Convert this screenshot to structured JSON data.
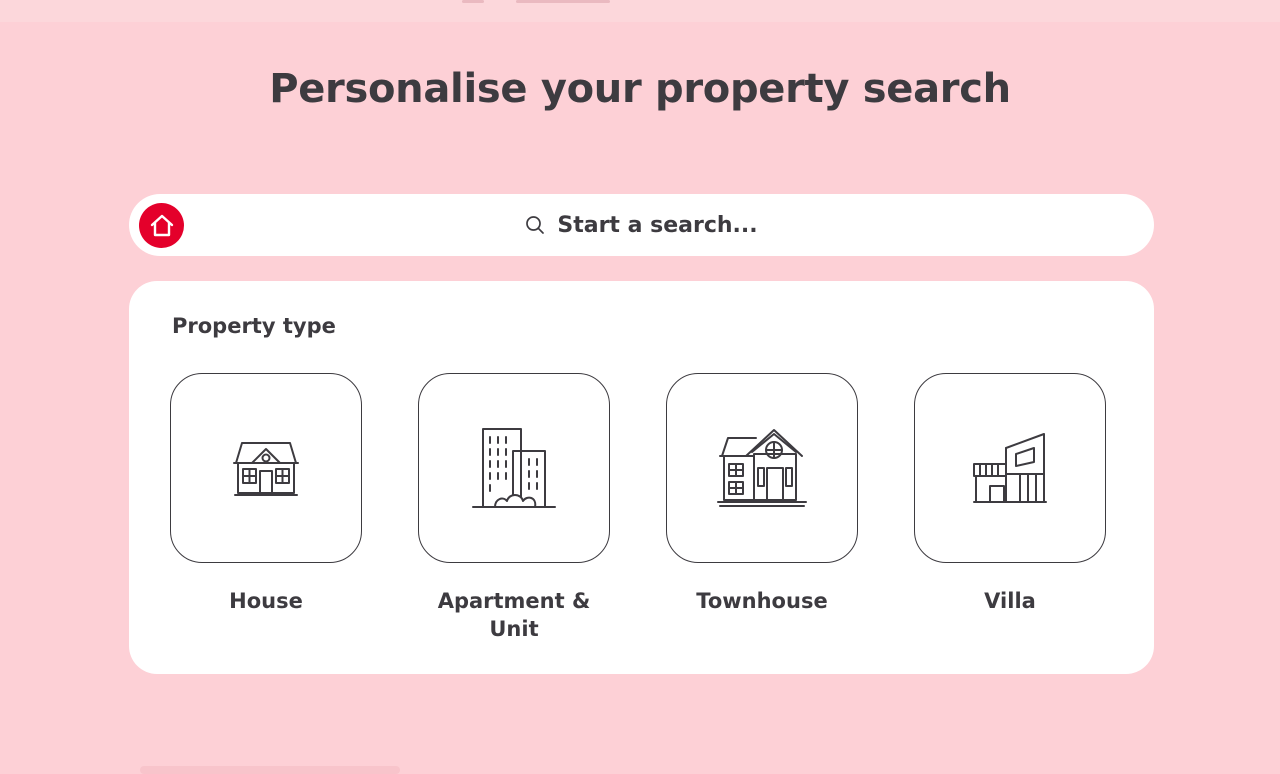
{
  "page": {
    "title": "Personalise your property search"
  },
  "search": {
    "placeholder": "Start a search...",
    "logo_icon": "house-icon",
    "search_icon": "search-icon"
  },
  "property_type": {
    "label": "Property type",
    "options": [
      {
        "label_lines": [
          "House"
        ],
        "icon": "house-icon"
      },
      {
        "label_lines": [
          "Apartment &",
          "Unit"
        ],
        "icon": "apartment-icon"
      },
      {
        "label_lines": [
          "Townhouse"
        ],
        "icon": "townhouse-icon"
      },
      {
        "label_lines": [
          "Villa"
        ],
        "icon": "villa-icon"
      }
    ]
  },
  "colors": {
    "background": "#fdd0d6",
    "brand_red": "#e4002b",
    "text": "#3d3b40",
    "card": "#ffffff"
  }
}
